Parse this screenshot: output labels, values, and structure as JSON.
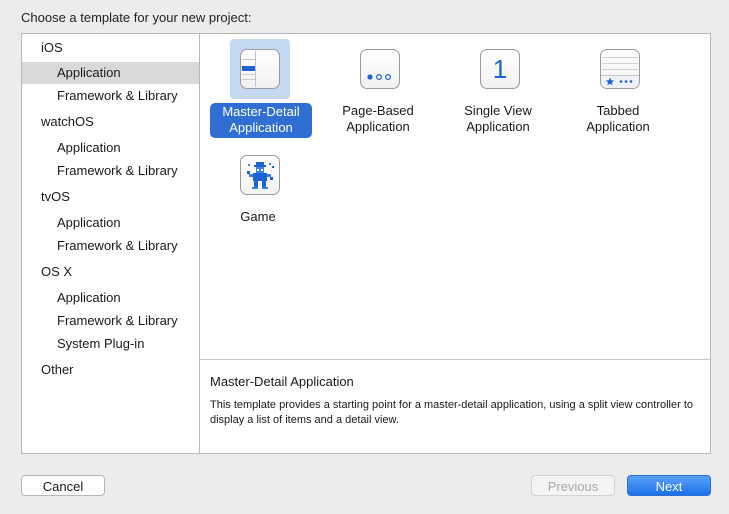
{
  "dialog": {
    "title": "Choose a template for your new project:"
  },
  "sidebar": {
    "items": [
      {
        "label": "iOS",
        "kind": "category"
      },
      {
        "label": "Application",
        "kind": "sub",
        "selected": true
      },
      {
        "label": "Framework & Library",
        "kind": "sub"
      },
      {
        "label": "watchOS",
        "kind": "category"
      },
      {
        "label": "Application",
        "kind": "sub"
      },
      {
        "label": "Framework & Library",
        "kind": "sub"
      },
      {
        "label": "tvOS",
        "kind": "category"
      },
      {
        "label": "Application",
        "kind": "sub"
      },
      {
        "label": "Framework & Library",
        "kind": "sub"
      },
      {
        "label": "OS X",
        "kind": "category"
      },
      {
        "label": "Application",
        "kind": "sub"
      },
      {
        "label": "Framework & Library",
        "kind": "sub"
      },
      {
        "label": "System Plug-in",
        "kind": "sub"
      },
      {
        "label": "Other",
        "kind": "category"
      }
    ]
  },
  "templates": [
    {
      "line1": "Master-Detail",
      "line2": "Application",
      "icon": "master-detail-icon",
      "selected": true
    },
    {
      "line1": "Page-Based",
      "line2": "Application",
      "icon": "page-based-icon"
    },
    {
      "line1": "Single View",
      "line2": "Application",
      "icon": "single-view-icon",
      "glyph": "1"
    },
    {
      "line1": "Tabbed",
      "line2": "Application",
      "icon": "tabbed-icon"
    },
    {
      "line1": "Game",
      "line2": "",
      "icon": "game-icon"
    }
  ],
  "description": {
    "title": "Master-Detail Application",
    "text": "This template provides a starting point for a master-detail application, using a split view controller to display a list of items and a detail view."
  },
  "buttons": {
    "cancel": "Cancel",
    "previous": "Previous",
    "next": "Next"
  },
  "colors": {
    "accent": "#2f6fd3",
    "selection_bg": "#c5d8f2",
    "sidebar_selection": "#d9d9d9"
  }
}
